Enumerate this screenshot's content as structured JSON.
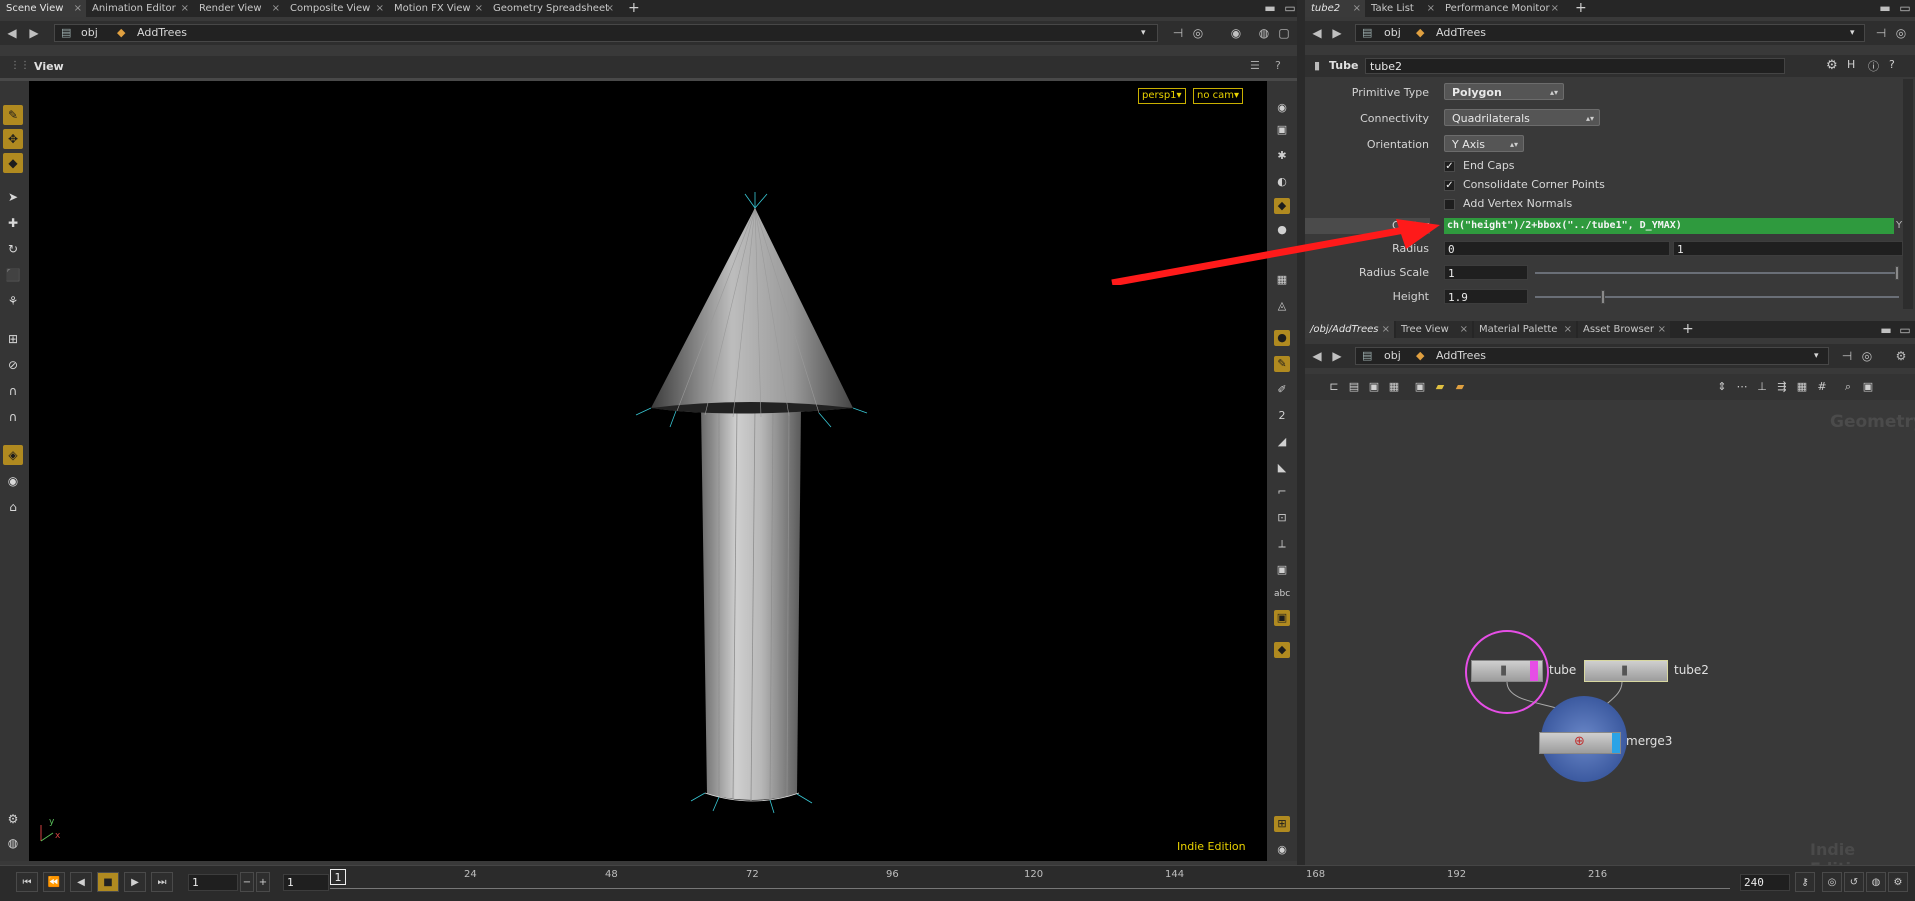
{
  "top_tabs": [
    {
      "label": "Scene View"
    },
    {
      "label": "Animation Editor"
    },
    {
      "label": "Render View"
    },
    {
      "label": "Composite View"
    },
    {
      "label": "Motion FX View"
    },
    {
      "label": "Geometry Spreadsheet"
    }
  ],
  "right_tabs": [
    {
      "label": "tube2"
    },
    {
      "label": "Take List"
    },
    {
      "label": "Performance Monitor"
    }
  ],
  "path": {
    "root": "obj",
    "node": "AddTrees"
  },
  "viewport": {
    "title": "View",
    "camera_menu": "persp1▾",
    "cam_menu": "no cam▾",
    "edition": "Indie Edition",
    "axis_x": "x",
    "axis_y": "y"
  },
  "params": {
    "node_type": "Tube",
    "node_name": "tube2",
    "primitive_type_label": "Primitive Type",
    "primitive_type": "Polygon",
    "connectivity_label": "Connectivity",
    "connectivity": "Quadrilaterals",
    "orientation_label": "Orientation",
    "orientation": "Y Axis",
    "end_caps": "End Caps",
    "consolidate": "Consolidate Corner Points",
    "vertex_normals": "Add Vertex Normals",
    "center_label": "Center",
    "center_expr": "ch(\"height\")/2+bbox(\"../tube1\", D_YMAX)",
    "center_y": "Y",
    "radius_label": "Radius",
    "radius_1": "0",
    "radius_2": "1",
    "radius_scale_label": "Radius Scale",
    "radius_scale": "1",
    "height_label": "Height",
    "height": "1.9"
  },
  "network_tabs": [
    {
      "label": "/obj/AddTrees"
    },
    {
      "label": "Tree View"
    },
    {
      "label": "Material Palette"
    },
    {
      "label": "Asset Browser"
    }
  ],
  "network": {
    "context_label": "Geometry",
    "edition": "Indie Edition",
    "nodes": [
      {
        "name": "tube"
      },
      {
        "name": "tube2"
      },
      {
        "name": "merge3"
      }
    ]
  },
  "timeline": {
    "frame": "1",
    "start": "1",
    "step": "1",
    "end": "240",
    "ticks": [
      "24",
      "48",
      "72",
      "96",
      "120",
      "144",
      "168",
      "192",
      "216"
    ],
    "current_marker": "1"
  },
  "colors": {
    "accent": "#b08a20",
    "expression_bg": "#2f9a3e",
    "arrow": "#ff1a1a",
    "node_selected": "#e64ee6"
  }
}
